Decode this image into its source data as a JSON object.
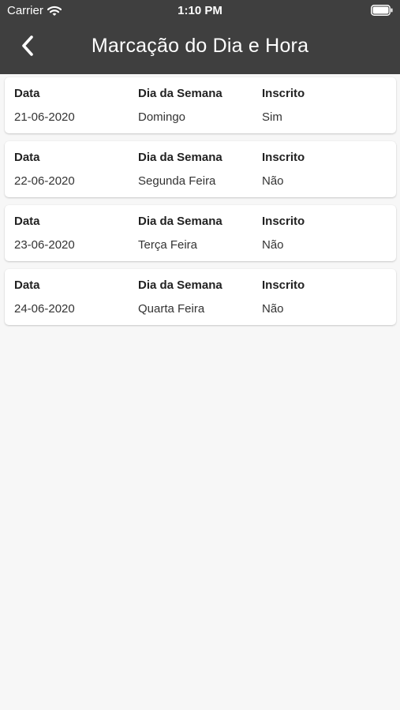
{
  "status_bar": {
    "carrier": "Carrier",
    "time": "1:10 PM"
  },
  "header": {
    "title": "Marcação do Dia e Hora",
    "back_icon": "chevron-left-icon",
    "background_color": "#3f3f3f"
  },
  "columns": {
    "date_label": "Data",
    "weekday_label": "Dia da Semana",
    "enrolled_label": "Inscrito"
  },
  "entries": [
    {
      "date": "21-06-2020",
      "weekday": "Domingo",
      "enrolled": "Sim"
    },
    {
      "date": "22-06-2020",
      "weekday": "Segunda Feira",
      "enrolled": "Não"
    },
    {
      "date": "23-06-2020",
      "weekday": "Terça Feira",
      "enrolled": "Não"
    },
    {
      "date": "24-06-2020",
      "weekday": "Quarta Feira",
      "enrolled": "Não"
    }
  ]
}
